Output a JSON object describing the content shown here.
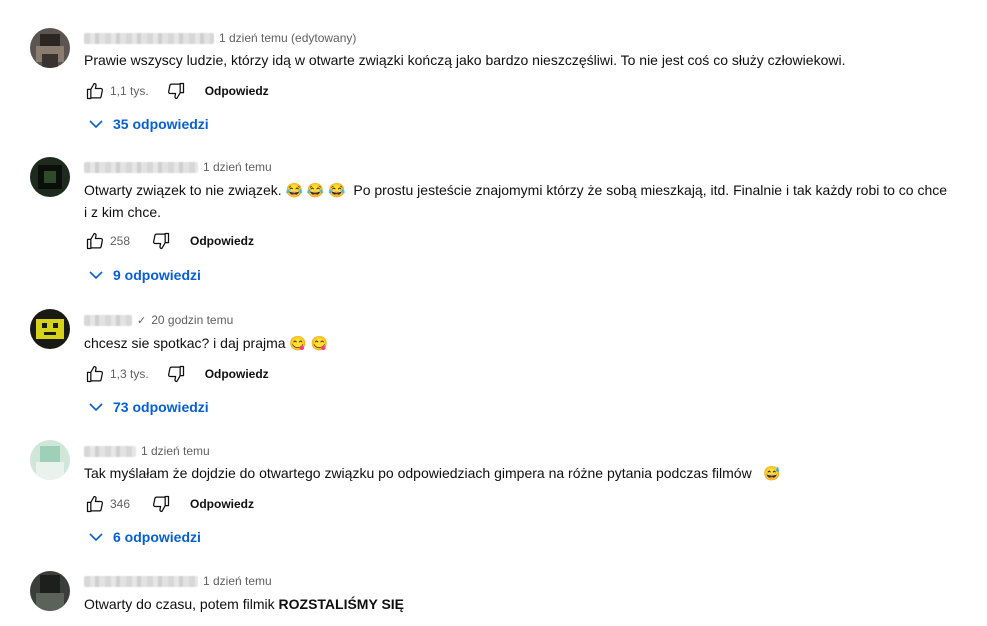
{
  "comments": [
    {
      "author": "",
      "timestamp": "1 dzień temu (edytowany)",
      "text": "Prawie wszyscy ludzie, którzy idą w otwarte związki kończą jako bardzo nieszczęśliwi. To nie jest coś co służy człowiekowi.",
      "like_count": "1,1 tys.",
      "reply_label": "Odpowiedz",
      "replies_label": "35 odpowiedzi"
    },
    {
      "author": "",
      "timestamp": "1 dzień temu",
      "text": "Otwarty związek to nie związek. 😂 😂 😂  Po prostu jesteście znajomymi którzy że sobą mieszkają, itd. Finalnie i tak każdy robi to co chce i z kim chce.",
      "like_count": "258",
      "reply_label": "Odpowiedz",
      "replies_label": "9 odpowiedzi"
    },
    {
      "author": "",
      "verified": "✓",
      "timestamp": "20 godzin temu",
      "text": "chcesz sie spotkac? i daj prajma 😋 😋",
      "like_count": "1,3 tys.",
      "reply_label": "Odpowiedz",
      "replies_label": "73 odpowiedzi"
    },
    {
      "author": "",
      "timestamp": "1 dzień temu",
      "text": "Tak myślałam że dojdzie do otwartego związku po odpowiedziach gimpera na różne pytania podczas filmów   😅",
      "like_count": "346",
      "reply_label": "Odpowiedz",
      "replies_label": "6 odpowiedzi"
    },
    {
      "author": "",
      "timestamp": "1 dzień temu",
      "text_plain": "Otwarty do czasu, potem filmik ",
      "text_bold": "ROZSTALIŚMY SIĘ"
    }
  ],
  "icons": {
    "like": "thumb-up-icon",
    "dislike": "thumb-down-icon",
    "expand": "chevron-down-icon"
  },
  "colors": {
    "link": "#065fd4",
    "meta_text": "#606060",
    "text": "#0f0f0f"
  }
}
